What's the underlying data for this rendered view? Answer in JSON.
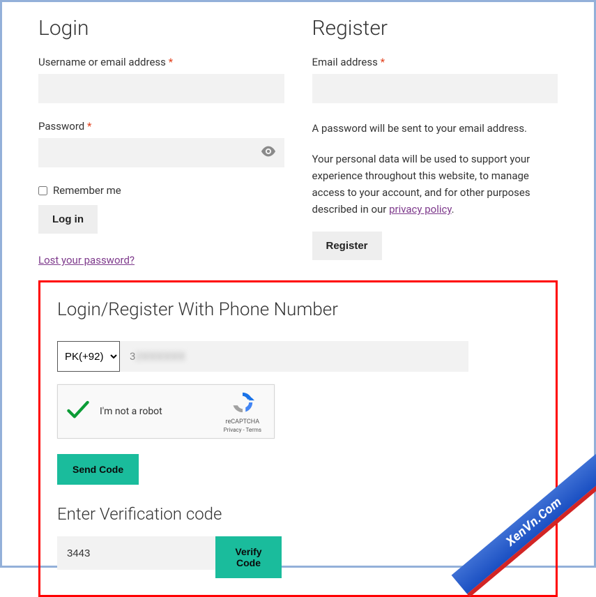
{
  "login": {
    "heading": "Login",
    "username_label": "Username or email address",
    "password_label": "Password",
    "remember_label": "Remember me",
    "login_button": "Log in",
    "lost_password_link": "Lost your password?",
    "required_marker": "*"
  },
  "register": {
    "heading": "Register",
    "email_label": "Email address",
    "password_hint": "A password will be sent to your email address.",
    "privacy_text_prefix": "Your personal data will be used to support your experience throughout this website, to manage access to your account, and for other purposes described in our ",
    "privacy_link": "privacy policy",
    "privacy_text_suffix": ".",
    "register_button": "Register",
    "required_marker": "*"
  },
  "phone": {
    "heading": "Login/Register With Phone Number",
    "country_code_value": "PK(+92)",
    "phone_value_leading": "3",
    "recaptcha_label": "I'm not a robot",
    "recaptcha_brand": "reCAPTCHA",
    "recaptcha_links": "Privacy - Terms",
    "send_button": "Send Code",
    "verify_heading": "Enter Verification code",
    "code_value": "3443",
    "verify_button": "Verify Code"
  },
  "watermark": {
    "text": "XenVn.Com"
  }
}
